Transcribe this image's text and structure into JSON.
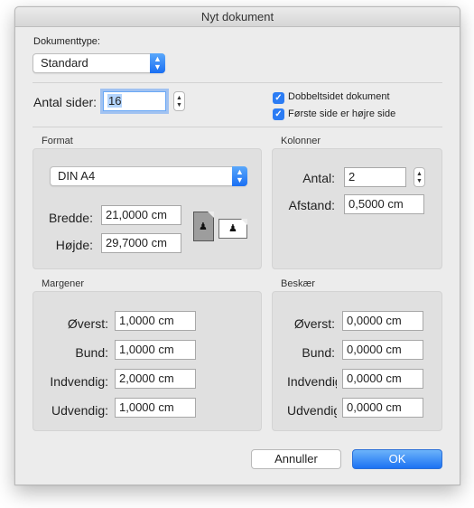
{
  "window": {
    "title": "Nyt dokument"
  },
  "doctype": {
    "label": "Dokumenttype:",
    "value": "Standard"
  },
  "pages": {
    "label": "Antal sider:",
    "value": "16",
    "double_sided_label": "Dobbeltsidet dokument",
    "double_sided_checked": true,
    "right_first_label": "Første side er højre side",
    "right_first_checked": true
  },
  "format": {
    "title": "Format",
    "paper": "DIN A4",
    "width_label": "Bredde:",
    "width_value": "21,0000 cm",
    "height_label": "Højde:",
    "height_value": "29,7000 cm",
    "orientation_selected": "portrait"
  },
  "columns": {
    "title": "Kolonner",
    "count_label": "Antal:",
    "count_value": "2",
    "gap_label": "Afstand:",
    "gap_value": "0,5000 cm"
  },
  "margins": {
    "title": "Margener",
    "top_label": "Øverst:",
    "top_value": "1,0000 cm",
    "bottom_label": "Bund:",
    "bottom_value": "1,0000 cm",
    "inside_label": "Indvendig:",
    "inside_value": "2,0000 cm",
    "outside_label": "Udvendig:",
    "outside_value": "1,0000 cm"
  },
  "bleed": {
    "title": "Beskær",
    "top_label": "Øverst:",
    "top_value": "0,0000 cm",
    "bottom_label": "Bund:",
    "bottom_value": "0,0000 cm",
    "inside_label": "Indvendig:",
    "inside_value": "0,0000 cm",
    "outside_label": "Udvendig:",
    "outside_value": "0,0000 cm"
  },
  "buttons": {
    "cancel": "Annuller",
    "ok": "OK"
  },
  "colors": {
    "accent": "#2b7cf4",
    "focus_ring": "#6aa8f5",
    "selection": "#b3d4fd"
  }
}
